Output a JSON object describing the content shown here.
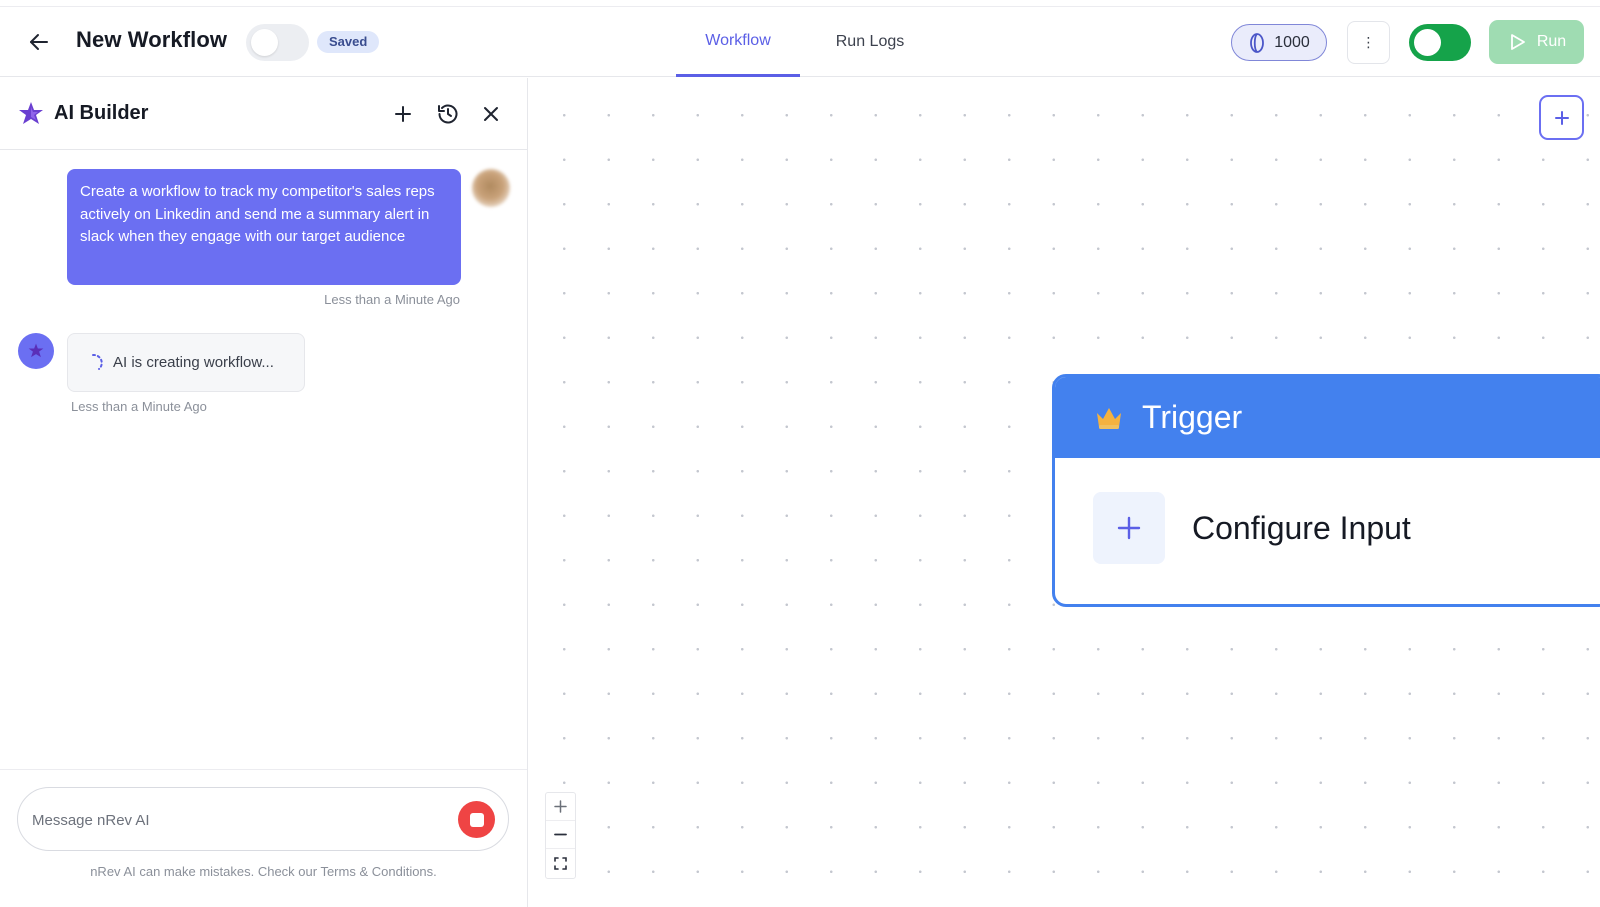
{
  "header": {
    "title": "New Workflow",
    "status_badge": "Saved",
    "tabs": [
      {
        "label": "Workflow",
        "active": true
      },
      {
        "label": "Run Logs",
        "active": false
      }
    ],
    "credits": "1000",
    "run_label": "Run",
    "published": true,
    "draft_toggle_on": false
  },
  "ai_panel": {
    "title": "AI Builder",
    "messages": [
      {
        "role": "user",
        "text": "Create a workflow to track my competitor's sales reps actively on Linkedin and send me a summary alert in slack when they engage with our target audience",
        "time": "Less than a Minute Ago"
      },
      {
        "role": "ai",
        "text": "AI is creating workflow...",
        "time": "Less than a Minute Ago"
      }
    ],
    "composer": {
      "placeholder": "Message nRev AI",
      "value": ""
    },
    "disclaimer": "nRev AI can make mistakes. Check our Terms & Conditions."
  },
  "canvas": {
    "trigger_node": {
      "title": "Trigger",
      "action_label": "Configure Input"
    }
  },
  "colors": {
    "accent": "#5b5fe6",
    "bubble": "#6b6ff2",
    "trigger": "#4381ee",
    "toggle_on": "#15a34a",
    "run_button": "#9fdcb2",
    "stop": "#ef4444"
  },
  "icons": {
    "back": "arrow-left-icon",
    "more": "kebab-icon",
    "credits": "coin-icon",
    "run": "play-icon",
    "logo": "sparkle-icon",
    "new_chat": "plus-icon",
    "history": "history-icon",
    "close": "close-icon",
    "spinner": "spinner-icon",
    "stop": "stop-icon",
    "trigger": "crown-icon",
    "zoom_in": "plus-icon",
    "zoom_out": "minus-icon",
    "fit_view": "fit-view-icon"
  }
}
